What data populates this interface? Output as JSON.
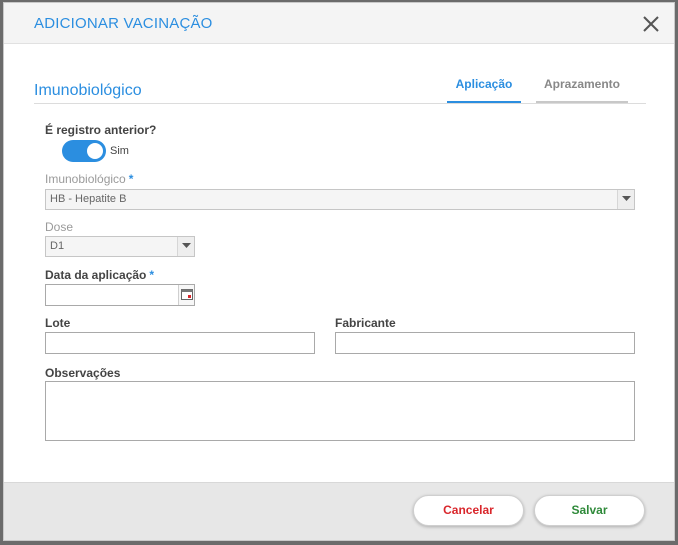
{
  "modal": {
    "title": "ADICIONAR VACINAÇÃO"
  },
  "section": {
    "title": "Imunobiológico"
  },
  "tabs": [
    {
      "label": "Aplicação",
      "active": true
    },
    {
      "label": "Aprazamento",
      "active": false
    }
  ],
  "form": {
    "registro_anterior": {
      "label": "É registro anterior?",
      "toggle_text": "Sim",
      "checked": true
    },
    "imunobiologico": {
      "label": "Imunobiológico",
      "required_mark": "*",
      "value": "HB - Hepatite B"
    },
    "dose": {
      "label": "Dose",
      "value": "D1"
    },
    "data_aplicacao": {
      "label": "Data da aplicação",
      "required_mark": "*",
      "value": ""
    },
    "lote": {
      "label": "Lote",
      "value": ""
    },
    "fabricante": {
      "label": "Fabricante",
      "value": ""
    },
    "observacoes": {
      "label": "Observações",
      "value": ""
    }
  },
  "footer": {
    "cancel_label": "Cancelar",
    "save_label": "Salvar"
  },
  "colors": {
    "accent": "#2b8ee0",
    "cancel": "#d9262b",
    "save": "#2f8a3a"
  },
  "icons": {
    "close": "close-icon",
    "dropdown": "chevron-down-icon",
    "calendar": "calendar-icon"
  }
}
